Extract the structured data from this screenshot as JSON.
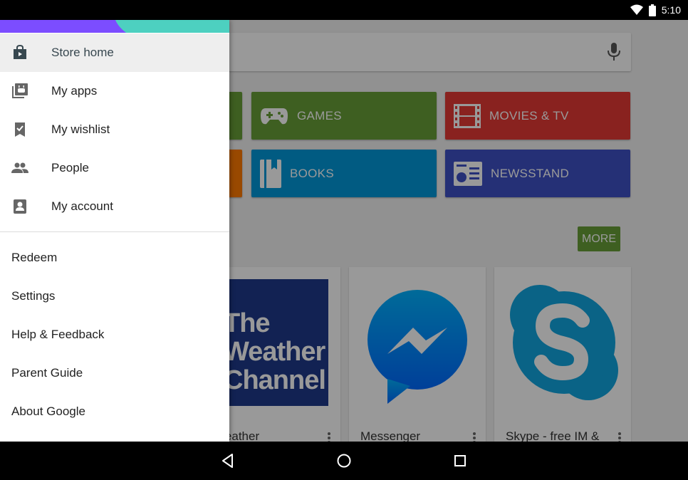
{
  "status_bar": {
    "time": "5:10"
  },
  "categories": [
    {
      "label": "GAMES",
      "icon": "gamepad-icon",
      "color": "#689f38"
    },
    {
      "label": "MOVIES & TV",
      "icon": "film-icon",
      "color": "#e53935"
    },
    {
      "label": "BOOKS",
      "icon": "book-icon",
      "color": "#0398d9"
    },
    {
      "label": "NEWSSTAND",
      "icon": "newspaper-icon",
      "color": "#3f51c5"
    }
  ],
  "more_label": "MORE",
  "cards": [
    {
      "title": "e Weather",
      "art_text": [
        "The",
        "Weather",
        "Channel"
      ]
    },
    {
      "title": "Messenger"
    },
    {
      "title": "Skype - free IM &"
    }
  ],
  "drawer": {
    "items": [
      {
        "label": "Store home",
        "icon": "store-home-icon",
        "active": true
      },
      {
        "label": "My apps",
        "icon": "my-apps-icon"
      },
      {
        "label": "My wishlist",
        "icon": "wishlist-icon"
      },
      {
        "label": "People",
        "icon": "people-icon"
      },
      {
        "label": "My account",
        "icon": "account-icon"
      }
    ],
    "secondary": [
      "Redeem",
      "Settings",
      "Help & Feedback",
      "Parent Guide",
      "About Google"
    ]
  },
  "colors": {
    "accent": "#689f38",
    "drawer_active_bg": "#eeeeee"
  }
}
